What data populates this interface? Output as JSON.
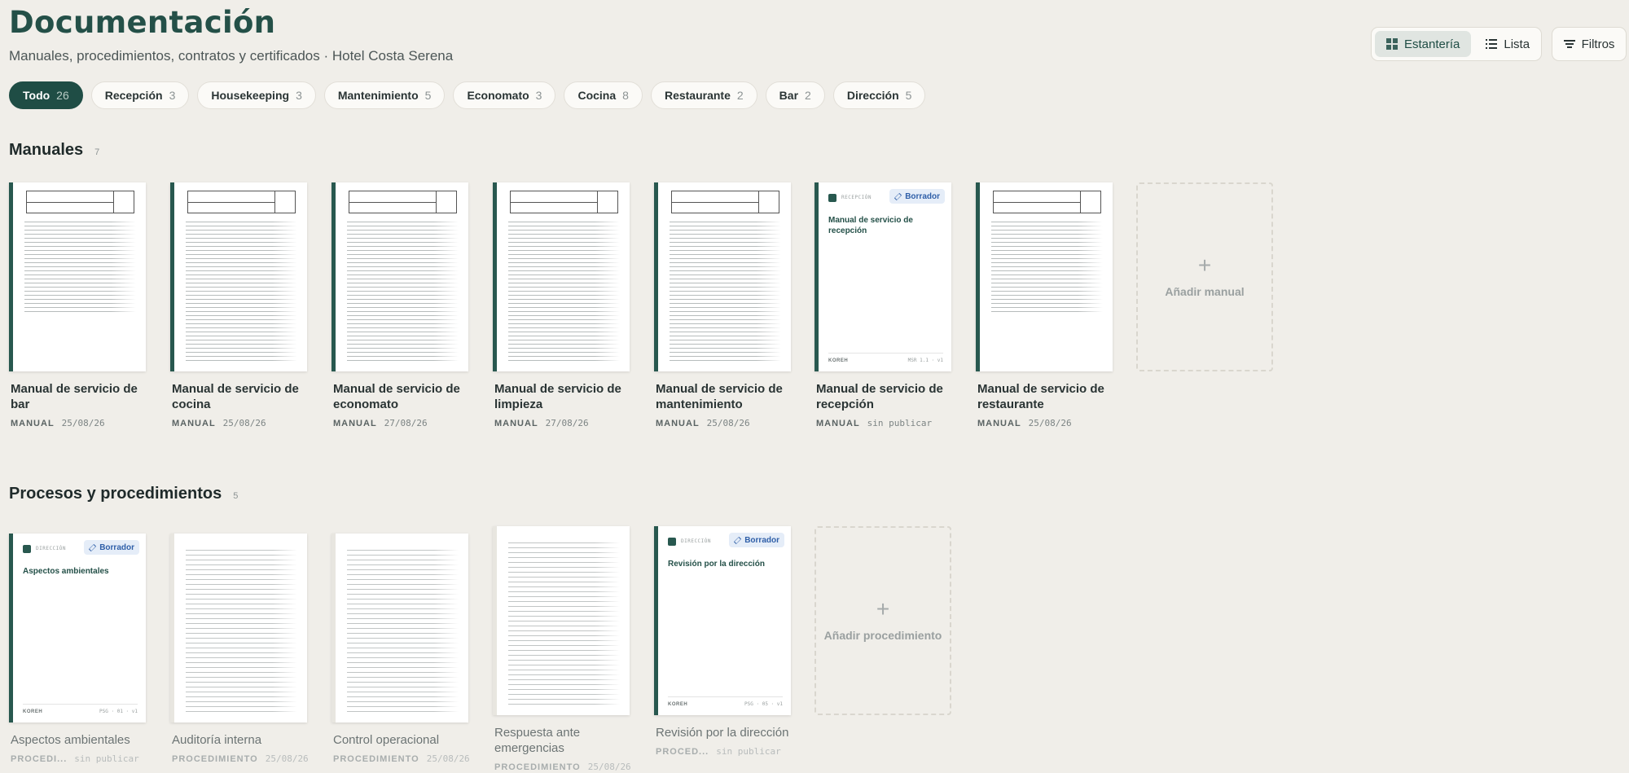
{
  "header": {
    "title": "Documentación",
    "subtitle": "Manuales, procedimientos, contratos y certificados · Hotel Costa Serena"
  },
  "view_toggle": {
    "shelf_label": "Estantería",
    "list_label": "Lista",
    "active": "Estantería"
  },
  "filters_label": "Filtros",
  "chips": [
    {
      "label": "Todo",
      "count": "26"
    },
    {
      "label": "Recepción",
      "count": "3"
    },
    {
      "label": "Housekeeping",
      "count": "3"
    },
    {
      "label": "Mantenimiento",
      "count": "5"
    },
    {
      "label": "Economato",
      "count": "3"
    },
    {
      "label": "Cocina",
      "count": "8"
    },
    {
      "label": "Restaurante",
      "count": "2"
    },
    {
      "label": "Bar",
      "count": "2"
    },
    {
      "label": "Dirección",
      "count": "5"
    }
  ],
  "sections": {
    "manuals": {
      "title": "Manuales",
      "count": "7",
      "add_label": "Añadir manual",
      "items": [
        {
          "title": "Manual de servicio de bar",
          "type": "MANUAL",
          "date": "25/08/26"
        },
        {
          "title": "Manual de servicio de cocina",
          "type": "MANUAL",
          "date": "25/08/26"
        },
        {
          "title": "Manual de servicio de economato",
          "type": "MANUAL",
          "date": "27/08/26"
        },
        {
          "title": "Manual de servicio de limpieza",
          "type": "MANUAL",
          "date": "27/08/26"
        },
        {
          "title": "Manual de servicio de mantenimiento",
          "type": "MANUAL",
          "date": "25/08/26"
        },
        {
          "title": "Manual de servicio de recepción",
          "type": "MANUAL",
          "date": "sin publicar",
          "draft": {
            "badge": "Borrador",
            "area": "RECEPCIÓN",
            "cover_title": "Manual de servicio de recepción",
            "brand": "KOREH",
            "code": "MSR 1.1 · v1"
          }
        },
        {
          "title": "Manual de servicio de restaurante",
          "type": "MANUAL",
          "date": "25/08/26"
        }
      ]
    },
    "procedures": {
      "title": "Procesos y procedimientos",
      "count": "5",
      "add_label": "Añadir procedimiento",
      "items": [
        {
          "title": "Aspectos ambientales",
          "type": "PROCEDI...",
          "date": "sin publicar",
          "draft": {
            "badge": "Borrador",
            "area": "DIRECCIÓN",
            "cover_title": "Aspectos ambientales",
            "brand": "KOREH",
            "code": "PSG · 01 · v1"
          }
        },
        {
          "title": "Auditoría interna",
          "type": "PROCEDIMIENTO",
          "date": "25/08/26"
        },
        {
          "title": "Control operacional",
          "type": "PROCEDIMIENTO",
          "date": "25/08/26"
        },
        {
          "title": "Respuesta ante emergencias",
          "type": "PROCEDIMIENTO",
          "date": "25/08/26"
        },
        {
          "title": "Revisión por la dirección",
          "type": "PROCED...",
          "date": "sin publicar",
          "draft": {
            "badge": "Borrador",
            "area": "DIRECCIÓN",
            "cover_title": "Revisión por la dirección",
            "brand": "KOREH",
            "code": "PSG · 05 · v1"
          }
        }
      ]
    }
  }
}
